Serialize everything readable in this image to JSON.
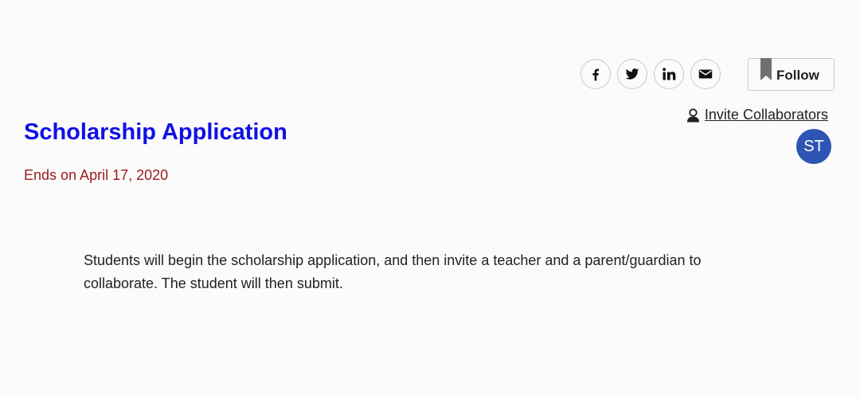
{
  "share": {
    "items": [
      {
        "icon": "facebook-icon"
      },
      {
        "icon": "twitter-icon"
      },
      {
        "icon": "linkedin-icon"
      },
      {
        "icon": "email-icon"
      }
    ]
  },
  "follow": {
    "label": "Follow",
    "icon": "bookmark-icon"
  },
  "invite": {
    "label": "Invite Collaborators",
    "icon": "user-icon"
  },
  "avatar": {
    "initials": "ST",
    "color": "#2e55b4"
  },
  "page": {
    "title": "Scholarship Application",
    "end_date": "Ends on April 17, 2020",
    "description": "Students will begin the scholarship application, and then invite a teacher and a parent/guardian to collaborate. The student will then submit."
  },
  "colors": {
    "title": "#1010e8",
    "end_date": "#9b1b1b",
    "background": "#fbfbfb"
  }
}
